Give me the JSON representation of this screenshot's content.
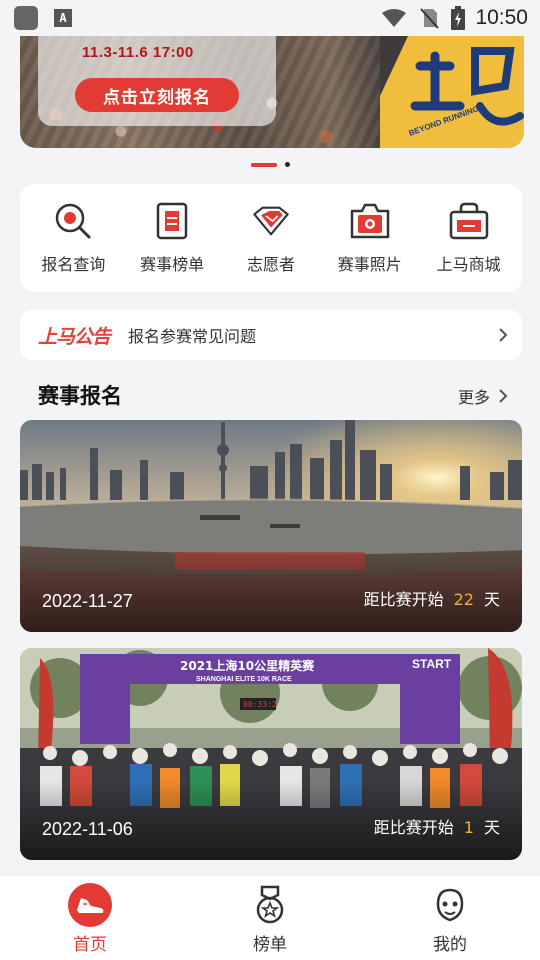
{
  "status_bar": {
    "time": "10:50",
    "icons": [
      "app-square-icon",
      "a-text-icon",
      "wifi-icon",
      "no-sim-icon",
      "battery-charging-icon"
    ]
  },
  "banner": {
    "date_range": "11.3-11.6  17:00",
    "cta_label": "点击立刻报名",
    "logo_text": "上马",
    "logo_subtext": "BEYOND RUNNING",
    "accent_color": "#e23b33",
    "logo_bg": "#f0bd3c",
    "slide_count": 2,
    "active_slide": 1
  },
  "quick_entries": [
    {
      "icon": "search-query-icon",
      "label": "报名查询"
    },
    {
      "icon": "ranking-list-icon",
      "label": "赛事榜单"
    },
    {
      "icon": "volunteer-diamond-icon",
      "label": "志愿者"
    },
    {
      "icon": "camera-icon",
      "label": "赛事照片"
    },
    {
      "icon": "shopping-basket-icon",
      "label": "上马商城"
    }
  ],
  "notice": {
    "logo": "上马公告",
    "text": "报名参赛常见问题"
  },
  "section": {
    "title": "赛事报名",
    "more_label": "更多"
  },
  "events": [
    {
      "date": "2022-11-27",
      "countdown_prefix": "距比赛开始",
      "days": "22",
      "unit": "天",
      "image": "shanghai-bund-skyline"
    },
    {
      "date": "2022-11-06",
      "countdown_prefix": "距比赛开始",
      "days": "1",
      "unit": "天",
      "image": "marathon-start-line-crowd",
      "arch_text": "2021上海10公里精英赛",
      "arch_subtext": "SHANGHAI ELITE 10K RACE",
      "start_text": "START",
      "clock": "00:33:2"
    }
  ],
  "bottom_nav": [
    {
      "icon": "running-shoe-icon",
      "label": "首页",
      "active": true
    },
    {
      "icon": "medal-icon",
      "label": "榜单",
      "active": false
    },
    {
      "icon": "smiley-face-icon",
      "label": "我的",
      "active": false
    }
  ],
  "colors": {
    "accent": "#e23b33",
    "countdown_days": "#f1b32e",
    "page_bg": "#f4f4f6"
  }
}
